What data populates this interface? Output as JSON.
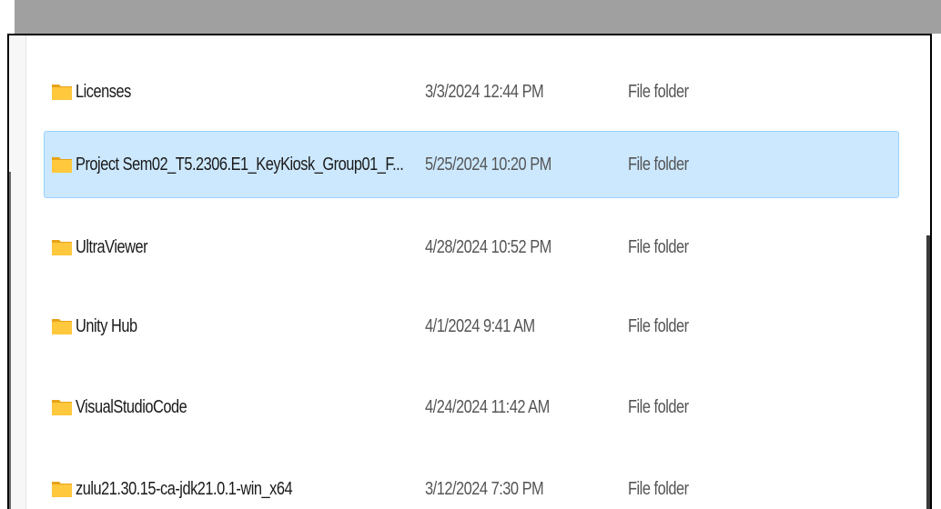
{
  "file_list": {
    "rows": [
      {
        "name": "Licenses",
        "modified": "3/3/2024 12:44 PM",
        "type": "File folder",
        "selected": false
      },
      {
        "name": "Project Sem02_T5.2306.E1_KeyKiosk_Group01_F...",
        "modified": "5/25/2024 10:20 PM",
        "type": "File folder",
        "selected": true
      },
      {
        "name": "UltraViewer",
        "modified": "4/28/2024 10:52 PM",
        "type": "File folder",
        "selected": false
      },
      {
        "name": "Unity Hub",
        "modified": "4/1/2024 9:41 AM",
        "type": "File folder",
        "selected": false
      },
      {
        "name": "VisualStudioCode",
        "modified": "4/24/2024 11:42 AM",
        "type": "File folder",
        "selected": false
      },
      {
        "name": "zulu21.30.15-ca-jdk21.0.1-win_x64",
        "modified": "3/12/2024 7:30 PM",
        "type": "File folder",
        "selected": false
      }
    ]
  },
  "icons": {
    "folder": "folder-icon"
  },
  "colors": {
    "selection_fill": "#cce8ff",
    "selection_border": "#99d1ff",
    "folder_yellow": "#ffc83d",
    "folder_dark": "#e8a317"
  }
}
